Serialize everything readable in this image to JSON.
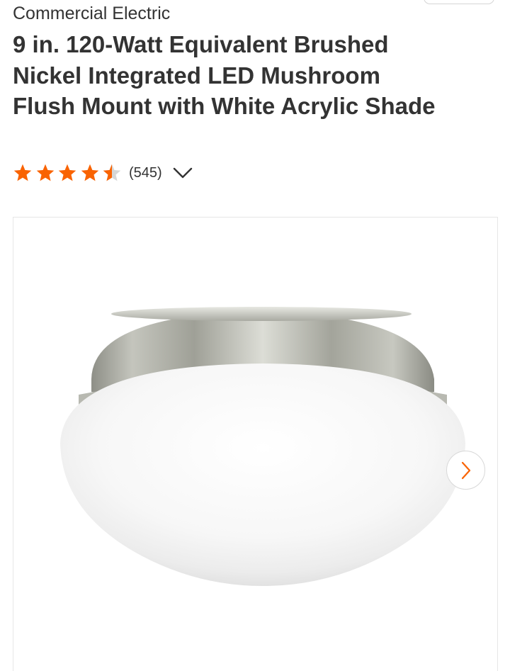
{
  "product": {
    "brand": "Commercial Electric",
    "title": "9 in. 120-Watt Equivalent Brushed Nickel Integrated LED Mushroom Flush Mount with White Acrylic Shade"
  },
  "rating": {
    "stars": 4.5,
    "max_stars": 5,
    "review_count": "(545)",
    "expand_icon": "chevron-down-icon"
  },
  "gallery": {
    "image_description": "brushed-nickel-mushroom-flush-mount",
    "next_icon": "chevron-right-icon"
  },
  "colors": {
    "accent": "#f96302",
    "star_empty": "#d6d6d6",
    "text": "#333333"
  }
}
